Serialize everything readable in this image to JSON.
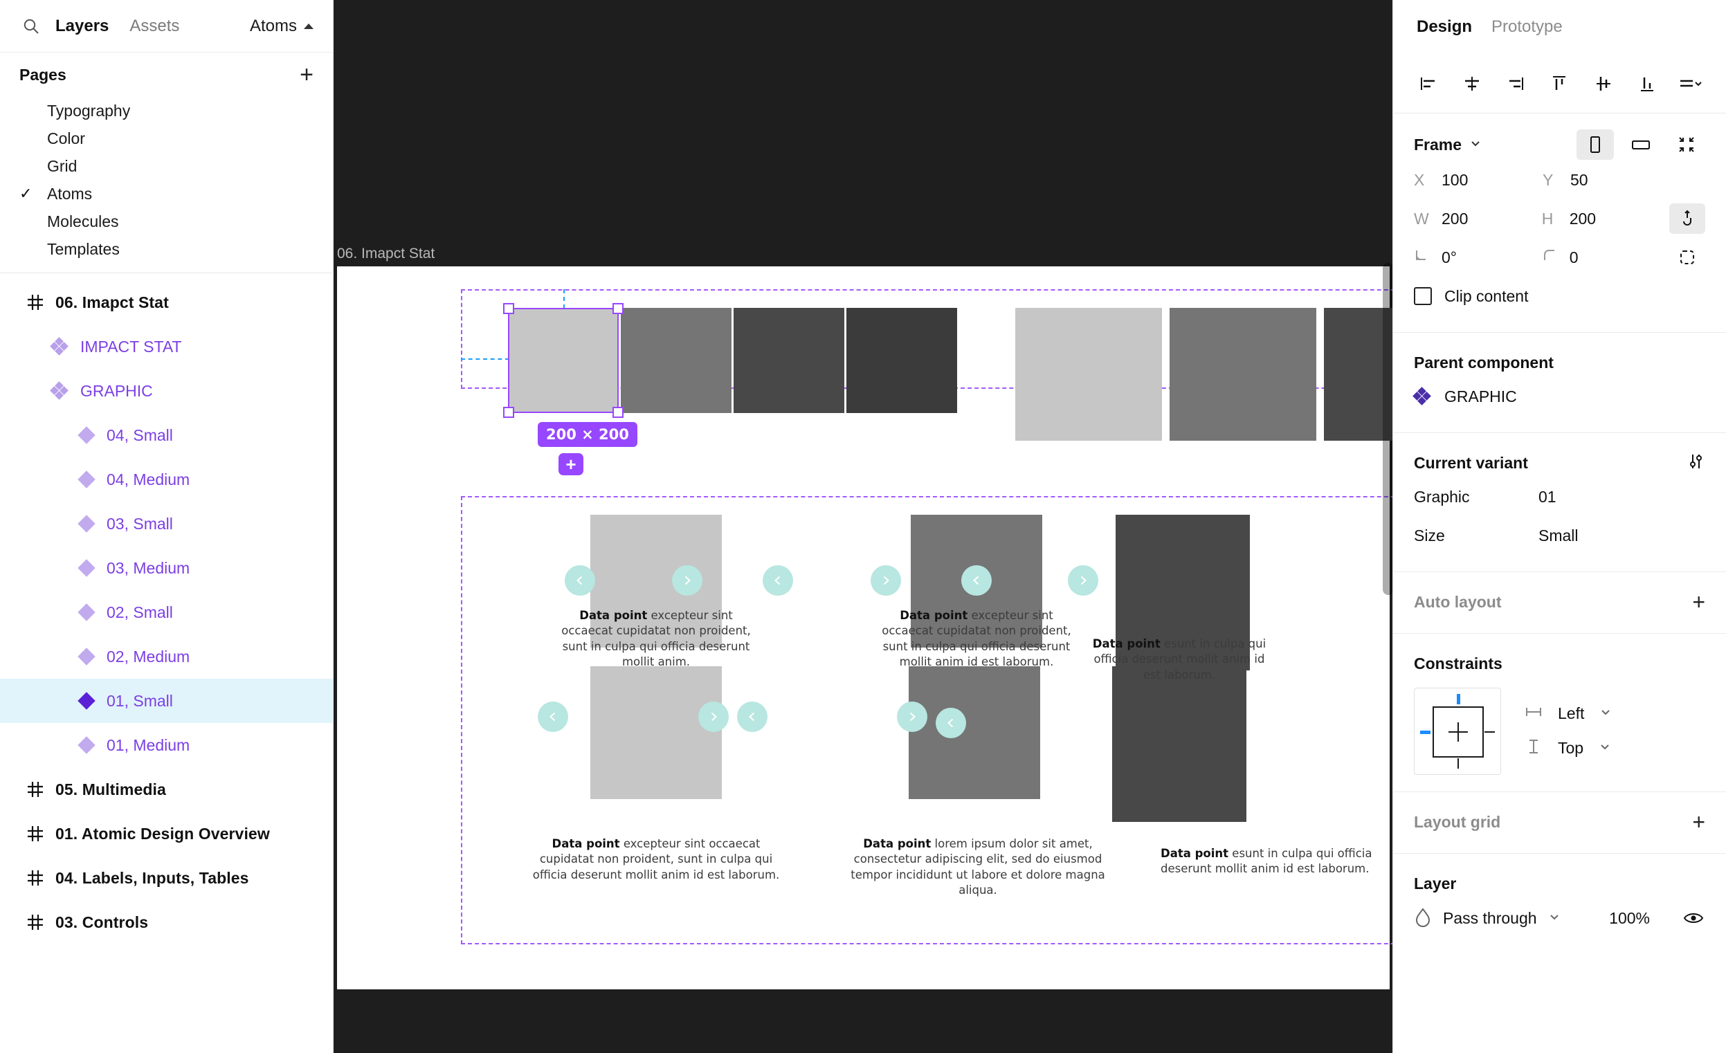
{
  "left_panel": {
    "tabs": {
      "layers": "Layers",
      "assets": "Assets"
    },
    "search_icon": "search-icon",
    "current_page_name": "Atoms",
    "pages_header": {
      "title": "Pages",
      "add_label": "+"
    },
    "pages": [
      {
        "label": "Typography",
        "checked": ""
      },
      {
        "label": "Color",
        "checked": ""
      },
      {
        "label": "Grid",
        "checked": ""
      },
      {
        "label": "Atoms",
        "checked": "✓"
      },
      {
        "label": "Molecules",
        "checked": ""
      },
      {
        "label": "Templates",
        "checked": ""
      }
    ],
    "layers": [
      {
        "name": "06. Imapct Stat",
        "type": "frame",
        "selected": false
      },
      {
        "name": "IMPACT STAT",
        "type": "component-set",
        "selected": false
      },
      {
        "name": "GRAPHIC",
        "type": "component-set",
        "selected": false
      },
      {
        "name": "04, Small",
        "type": "variant",
        "selected": false
      },
      {
        "name": "04, Medium",
        "type": "variant",
        "selected": false
      },
      {
        "name": "03, Small",
        "type": "variant",
        "selected": false
      },
      {
        "name": "03, Medium",
        "type": "variant",
        "selected": false
      },
      {
        "name": "02, Small",
        "type": "variant",
        "selected": false
      },
      {
        "name": "02, Medium",
        "type": "variant",
        "selected": false
      },
      {
        "name": "01, Small",
        "type": "variant",
        "selected": true
      },
      {
        "name": "01, Medium",
        "type": "variant",
        "selected": false
      },
      {
        "name": "05. Multimedia",
        "type": "frame",
        "selected": false
      },
      {
        "name": "01. Atomic Design Overview",
        "type": "frame",
        "selected": false
      },
      {
        "name": "04. Labels, Inputs, Tables",
        "type": "frame",
        "selected": false
      },
      {
        "name": "03. Controls",
        "type": "frame",
        "selected": false
      }
    ]
  },
  "canvas": {
    "frame_label": "06. Imapct Stat",
    "selection": {
      "size_badge": "200 × 200",
      "add_chip": "+"
    },
    "captions": [
      {
        "lead": "Data point",
        "text": " excepteur sint occaecat cupidatat non proident, sunt in culpa qui officia deserunt mollit anim."
      },
      {
        "lead": "Data point",
        "text": " excepteur sint occaecat cupidatat non proident, sunt in culpa qui officia deserunt mollit anim id est laborum."
      },
      {
        "lead": "Data point",
        "text": " esunt in culpa qui officia deserunt mollit anim id est laborum."
      },
      {
        "lead": "Data point",
        "text": " excepteur sint occaecat cupidatat non proident, sunt in culpa qui officia deserunt mollit anim id est laborum."
      },
      {
        "lead": "Data point",
        "text": " lorem ipsum dolor sit amet, consectetur adipiscing elit, sed do eiusmod tempor incididunt ut labore et dolore magna aliqua."
      },
      {
        "lead": "Data point",
        "text": " esunt in culpa qui officia deserunt mollit anim id est laborum."
      }
    ],
    "swatch_colors": {
      "light": "#c6c6c6",
      "mid": "#757575",
      "dark": "#484848",
      "darkest": "#3b3b3b"
    },
    "arrow_color": "#b8e6e0",
    "selection_color": "#9747ff",
    "guide_color": "#18a0fb"
  },
  "right_panel": {
    "tabs": {
      "design": "Design",
      "prototype": "Prototype"
    },
    "align_icons": [
      "align-left-icon",
      "align-horizontal-center-icon",
      "align-right-icon",
      "align-top-icon",
      "align-vertical-center-icon",
      "align-bottom-icon",
      "distribute-menu-icon"
    ],
    "frame": {
      "title": "Frame",
      "orientation_portrait_icon": "portrait-icon",
      "orientation_landscape_icon": "landscape-icon",
      "resize_to_fit_icon": "resize-to-fit-icon",
      "x_key": "X",
      "x_value": "100",
      "y_key": "Y",
      "y_value": "50",
      "w_key": "W",
      "w_value": "200",
      "h_key": "H",
      "h_value": "200",
      "rotation_value": "0°",
      "corner_radius_value": "0",
      "constrain_proportions_icon": "constrain-proportions-icon",
      "independent_corners_icon": "independent-corners-icon",
      "clip_content_label": "Clip content",
      "clip_content_checked": false
    },
    "parent_component": {
      "title": "Parent component",
      "name": "GRAPHIC",
      "icon": "component-set-icon"
    },
    "current_variant": {
      "title": "Current variant",
      "settings_icon": "variant-settings-icon",
      "properties": [
        {
          "key": "Graphic",
          "value": "01"
        },
        {
          "key": "Size",
          "value": "Small"
        }
      ]
    },
    "auto_layout": {
      "title": "Auto layout",
      "add": "+"
    },
    "constraints": {
      "title": "Constraints",
      "horizontal": "Left",
      "vertical": "Top",
      "horizontal_icon": "horizontal-constraint-icon",
      "vertical_icon": "vertical-constraint-icon",
      "accent": "#1a8cff"
    },
    "layout_grid": {
      "title": "Layout grid",
      "add": "+"
    },
    "layer": {
      "title": "Layer",
      "blend_mode": "Pass through",
      "opacity": "100%",
      "blend_icon": "blend-mode-icon",
      "visibility_icon": "eye-icon"
    }
  }
}
